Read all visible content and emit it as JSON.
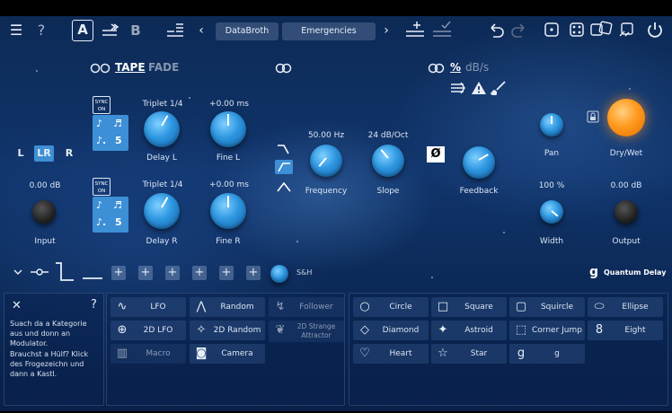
{
  "topbar": {
    "menu_icon": "☰",
    "help_label": "?",
    "preset_a": "A",
    "preset_b": "B",
    "prev_arrow": "‹",
    "next_arrow": "›",
    "bank_name": "DataBroth",
    "preset_name": "Emergencies"
  },
  "mode_tabs": {
    "tape": "TAPE",
    "fade": "FADE",
    "percent": "%",
    "db": "dB/s"
  },
  "delay_l": {
    "sync_label": "SYNC\nON",
    "notes": [
      "♪",
      "♬",
      "♪.",
      "5"
    ],
    "time_value": "Triplet 1/4",
    "time_label": "Delay L",
    "fine_value": "+0.00 ms",
    "fine_label": "Fine L"
  },
  "delay_r": {
    "sync_label": "SYNC\nON",
    "notes": [
      "♪",
      "♬",
      "♪.",
      "5"
    ],
    "time_value": "Triplet 1/4",
    "time_label": "Delay R",
    "fine_value": "+0.00 ms",
    "fine_label": "Fine R"
  },
  "channels": {
    "l": "L",
    "lr": "LR",
    "r": "R",
    "selected": "LR"
  },
  "input": {
    "value": "0.00 dB",
    "label": "Input"
  },
  "filter": {
    "frequency_value": "50.00 Hz",
    "frequency_label": "Frequency",
    "slope_value": "24 dB/Oct",
    "slope_label": "Slope",
    "feedback_label": "Feedback",
    "phase_symbol": "Ø"
  },
  "output_section": {
    "pan_label": "Pan",
    "drywet_label": "Dry/Wet",
    "width_value": "100 %",
    "width_label": "Width",
    "output_value": "0.00 dB",
    "output_label": "Output"
  },
  "modbar": {
    "sh_label": "S&H",
    "brand": "Quantum Delay"
  },
  "info_panel": {
    "close": "✕",
    "help": "?",
    "text1": "Suach da a Kategorie aus und donn an Modulator.",
    "text2": "Brauchst a Hülf? Klick des Frogezeichn und dann a Kastl."
  },
  "modulators": [
    {
      "label": "LFO",
      "icon": "∿",
      "enabled": true
    },
    {
      "label": "Random",
      "icon": "⋀",
      "enabled": true
    },
    {
      "label": "Follower",
      "icon": "↯",
      "enabled": false
    },
    {
      "label": "2D LFO",
      "icon": "⊕",
      "enabled": true
    },
    {
      "label": "2D Random",
      "icon": "✧",
      "enabled": true
    },
    {
      "label": "2D Strange Attractor",
      "icon": "❦",
      "enabled": false
    },
    {
      "label": "Macro",
      "icon": "▥",
      "enabled": false
    },
    {
      "label": "Camera",
      "icon": "◙",
      "enabled": true
    }
  ],
  "shapes": [
    {
      "label": "Circle",
      "icon": "○"
    },
    {
      "label": "Square",
      "icon": "□"
    },
    {
      "label": "Squircle",
      "icon": "▢"
    },
    {
      "label": "Ellipse",
      "icon": "⬭"
    },
    {
      "label": "Diamond",
      "icon": "◇"
    },
    {
      "label": "Astroid",
      "icon": "✦"
    },
    {
      "label": "Corner Jump",
      "icon": "⬚"
    },
    {
      "label": "Eight",
      "icon": "8"
    },
    {
      "label": "Heart",
      "icon": "♡"
    },
    {
      "label": "Star",
      "icon": "☆"
    },
    {
      "label": "g",
      "icon": "g"
    }
  ]
}
